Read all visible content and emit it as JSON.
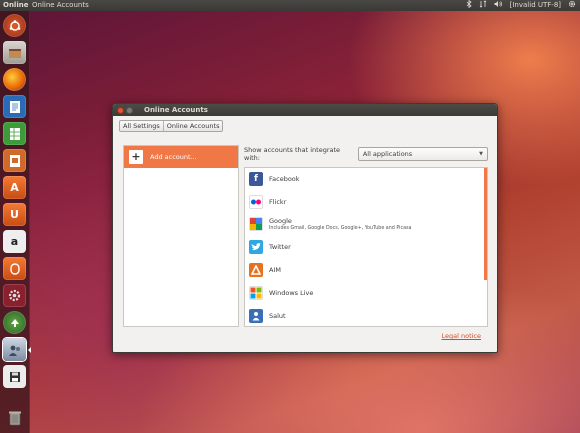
{
  "top_panel": {
    "app_name": "Online",
    "window_title": "Online Accounts",
    "keyboard_indicator": "[Invalid UTF-8]",
    "icons": [
      "bluetooth-icon",
      "network-icon",
      "volume-icon",
      "keyboard-icon",
      "gear-icon"
    ]
  },
  "launcher": {
    "items": [
      "dash-icon",
      "files-icon",
      "firefox-icon",
      "writer-icon",
      "calc-icon",
      "impress-icon",
      "software-center-icon",
      "ubuntu-one-icon",
      "amazon-icon",
      "ubuntu-one-music-icon",
      "system-settings-icon",
      "update-manager-icon",
      "online-accounts-icon",
      "save-icon",
      "trash-icon"
    ]
  },
  "window": {
    "title": "Online Accounts",
    "breadcrumbs": [
      "All Settings",
      "Online Accounts"
    ],
    "add_account_label": "Add account...",
    "filter_label": "Show accounts that integrate with:",
    "filter_value": "All applications",
    "providers": [
      {
        "name": "Facebook",
        "desc": "",
        "icon": "facebook-icon",
        "color": "#3b5998",
        "glyph": "f"
      },
      {
        "name": "Flickr",
        "desc": "",
        "icon": "flickr-icon",
        "color": "#ffffff",
        "glyph": ""
      },
      {
        "name": "Google",
        "desc": "Includes Gmail, Google Docs, Google+, YouTube and Picasa",
        "icon": "google-icon",
        "color": "#4a8af4",
        "glyph": ""
      },
      {
        "name": "Twitter",
        "desc": "",
        "icon": "twitter-icon",
        "color": "#2fa7e3",
        "glyph": ""
      },
      {
        "name": "AIM",
        "desc": "",
        "icon": "aim-icon",
        "color": "#f6a118",
        "glyph": "A"
      },
      {
        "name": "Windows Live",
        "desc": "",
        "icon": "windows-live-icon",
        "color": "#ffffff",
        "glyph": ""
      },
      {
        "name": "Salut",
        "desc": "",
        "icon": "salut-icon",
        "color": "#3a6fb8",
        "glyph": "♟"
      }
    ],
    "legal_notice": "Legal notice"
  },
  "colors": {
    "accent": "#f07746",
    "link": "#dd4814"
  }
}
